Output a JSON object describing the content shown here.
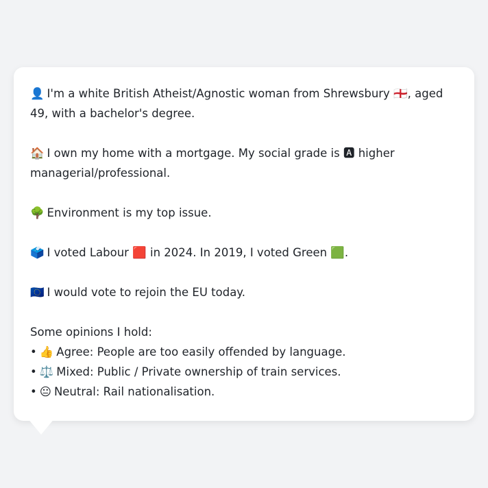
{
  "profile": {
    "line1": "I'm a white British Atheist/Agnostic woman from Shrewsbury 🏴󠁧󠁢󠁥󠁮󠁧󠁿, aged 49, with a bachelor's degree.",
    "line1_icon": "👤",
    "line2": "I own my home with a mortgage. My social grade is 🅰 higher managerial/professional.",
    "line2_icon": "🏠",
    "line3": "Environment is my top issue.",
    "line3_icon": "🌳",
    "line4": "I voted Labour 🟥 in 2024. In 2019, I voted Green 🟩.",
    "line4_icon": "🗳️",
    "line5": "I would vote to rejoin the EU today.",
    "line5_icon": "🇪🇺"
  },
  "opinions": {
    "heading": "Some opinions I hold:",
    "items": [
      {
        "icon": "👍",
        "text": "Agree: People are too easily offended by language."
      },
      {
        "icon": "⚖️",
        "text": "Mixed: Public / Private ownership of train services."
      },
      {
        "icon": "😐",
        "text": "Neutral: Rail nationalisation."
      }
    ]
  }
}
